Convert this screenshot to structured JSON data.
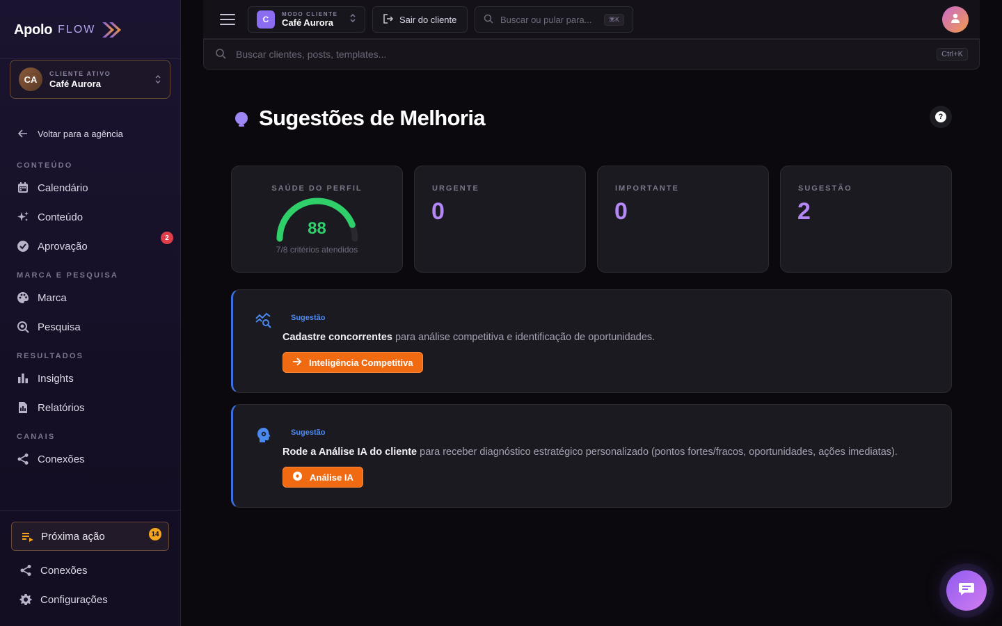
{
  "brand": {
    "name": "Apolo",
    "sub": "FLOW",
    "accent": "#8a6df0"
  },
  "sidebar": {
    "client_card": {
      "initials": "CA",
      "label": "CLIENTE ATIVO",
      "name": "Café Aurora"
    },
    "back_label": "Voltar para a agência",
    "sections": {
      "content": "CONTEÚDO",
      "brand": "MARCA E PESQUISA",
      "results": "RESULTADOS",
      "channels": "CANAIS"
    },
    "items": {
      "calendar": "Calendário",
      "content": "Conteúdo",
      "approval": "Aprovação",
      "approval_badge": "2",
      "brand": "Marca",
      "research": "Pesquisa",
      "insights": "Insights",
      "reports": "Relatórios",
      "connections": "Conexões"
    },
    "next_action": {
      "label": "Próxima ação",
      "badge": "14"
    },
    "bottom": {
      "connections": "Conexões",
      "settings": "Configurações"
    }
  },
  "topbar": {
    "mode_label": "MODO CLIENTE",
    "mode_initial": "C",
    "mode_name": "Café Aurora",
    "exit_label": "Sair do cliente",
    "quick_search_placeholder": "Buscar ou pular para...",
    "quick_search_kbd": "⌘K"
  },
  "global_search": {
    "placeholder": "Buscar clientes, posts, templates...",
    "kbd": "Ctrl+K"
  },
  "main": {
    "title": "Sugestões de Melhoria",
    "help": "?",
    "stats": {
      "health": {
        "label": "SAÚDE DO PERFIL",
        "value": "88",
        "score": 88,
        "max": 100,
        "sub": "7/8 critérios atendidos"
      },
      "urgent": {
        "label": "URGENTE",
        "value": "0"
      },
      "important": {
        "label": "IMPORTANTE",
        "value": "0"
      },
      "suggestion": {
        "label": "SUGESTÃO",
        "value": "2"
      }
    },
    "suggestions": [
      {
        "tag": "Sugestão",
        "bold": "Cadastre concorrentes",
        "text": " para análise competitiva e identificação de oportunidades.",
        "button": "Inteligência Competitiva",
        "icon": "competitor-analytics-icon"
      },
      {
        "tag": "Sugestão",
        "bold": "Rode a Análise IA do cliente",
        "text": " para receber diagnóstico estratégico personalizado (pontos fortes/fracos, oportunidades, ações imediatas).",
        "button": "Análise IA",
        "icon": "ai-brain-icon"
      }
    ]
  },
  "colors": {
    "gauge": "#2fcf6a",
    "stat_value": "#b388f5",
    "cta": "#f06a12",
    "tag": "#4a8af0"
  }
}
